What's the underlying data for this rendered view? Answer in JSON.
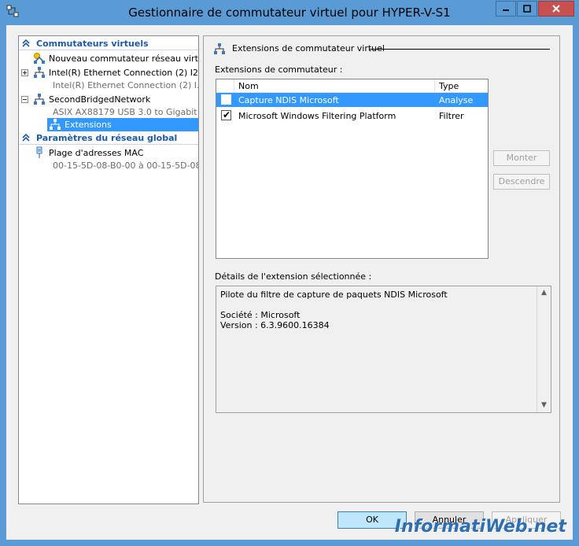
{
  "window": {
    "title": "Gestionnaire de commutateur virtuel pour HYPER-V-S1"
  },
  "tree": {
    "category1": "Commutateurs virtuels",
    "new_switch": "Nouveau commutateur réseau virtuel",
    "intel_switch": "Intel(R) Ethernet Connection (2) I2...",
    "intel_sub": "Intel(R) Ethernet Connection (2) I...",
    "second_switch": "SecondBridgedNetwork",
    "second_sub": "ASIX AX88179 USB 3.0 to Gigabit ...",
    "extensions": "Extensions",
    "category2": "Paramètres du réseau global",
    "mac_range": "Plage d'adresses MAC",
    "mac_sub": "00-15-5D-08-B0-00 à 00-15-5D-08...."
  },
  "panel": {
    "section_title": "Extensions de commutateur virtuel",
    "list_label": "Extensions de commutateur :",
    "col_name": "Nom",
    "col_type": "Type",
    "rows": [
      {
        "name": "Capture NDIS Microsoft",
        "type": "Analyse",
        "checked": false
      },
      {
        "name": "Microsoft Windows Filtering Platform",
        "type": "Filtrer",
        "checked": true
      }
    ],
    "btn_up": "Monter",
    "btn_down": "Descendre",
    "details_label": "Détails de l'extension sélectionnée :",
    "details_line1": "Pilote du filtre de capture de paquets NDIS Microsoft",
    "details_line2": "Société : Microsoft",
    "details_line3": "Version : 6.3.9600.16384"
  },
  "buttons": {
    "ok": "OK",
    "cancel": "Annuler",
    "apply": "Appliquer"
  },
  "watermark": "InformatiWeb.net",
  "colors": {
    "titlebar": "#5a9bd5",
    "selection": "#3399ff",
    "category": "#1e5aa8"
  }
}
